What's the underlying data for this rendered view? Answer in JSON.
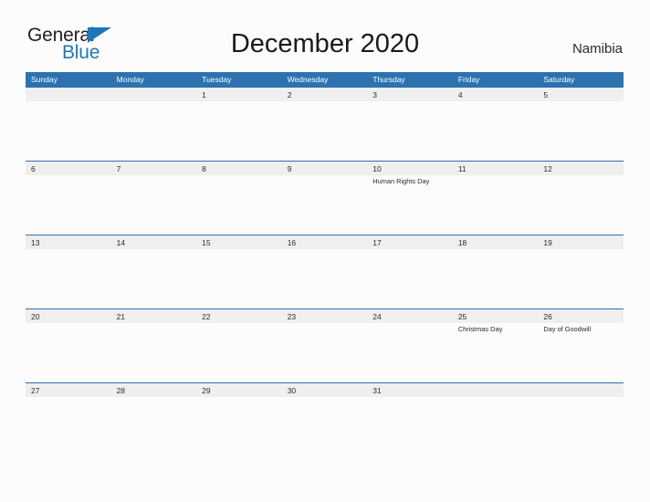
{
  "brand": {
    "name_part1": "General",
    "name_part2": "Blue",
    "accent_color": "#1f76bc"
  },
  "header": {
    "title": "December 2020",
    "country": "Namibia"
  },
  "theme": {
    "header_blue": "#2c72b0",
    "band_gray": "#efefef",
    "page_background": "#fcfcfc",
    "text_color": "#2b2b2b"
  },
  "calendar": {
    "month": "December",
    "year": "2020",
    "weekday_headers": [
      "Sunday",
      "Monday",
      "Tuesday",
      "Wednesday",
      "Thursday",
      "Friday",
      "Saturday"
    ],
    "weeks": [
      {
        "days": [
          {
            "number": "",
            "events": []
          },
          {
            "number": "",
            "events": []
          },
          {
            "number": "1",
            "events": []
          },
          {
            "number": "2",
            "events": []
          },
          {
            "number": "3",
            "events": []
          },
          {
            "number": "4",
            "events": []
          },
          {
            "number": "5",
            "events": []
          }
        ]
      },
      {
        "days": [
          {
            "number": "6",
            "events": []
          },
          {
            "number": "7",
            "events": []
          },
          {
            "number": "8",
            "events": []
          },
          {
            "number": "9",
            "events": []
          },
          {
            "number": "10",
            "events": [
              "Human Rights Day"
            ]
          },
          {
            "number": "11",
            "events": []
          },
          {
            "number": "12",
            "events": []
          }
        ]
      },
      {
        "days": [
          {
            "number": "13",
            "events": []
          },
          {
            "number": "14",
            "events": []
          },
          {
            "number": "15",
            "events": []
          },
          {
            "number": "16",
            "events": []
          },
          {
            "number": "17",
            "events": []
          },
          {
            "number": "18",
            "events": []
          },
          {
            "number": "19",
            "events": []
          }
        ]
      },
      {
        "days": [
          {
            "number": "20",
            "events": []
          },
          {
            "number": "21",
            "events": []
          },
          {
            "number": "22",
            "events": []
          },
          {
            "number": "23",
            "events": []
          },
          {
            "number": "24",
            "events": []
          },
          {
            "number": "25",
            "events": [
              "Christmas Day"
            ]
          },
          {
            "number": "26",
            "events": [
              "Day of Goodwill"
            ]
          }
        ]
      },
      {
        "days": [
          {
            "number": "27",
            "events": []
          },
          {
            "number": "28",
            "events": []
          },
          {
            "number": "29",
            "events": []
          },
          {
            "number": "30",
            "events": []
          },
          {
            "number": "31",
            "events": []
          },
          {
            "number": "",
            "events": []
          },
          {
            "number": "",
            "events": []
          }
        ]
      }
    ]
  }
}
